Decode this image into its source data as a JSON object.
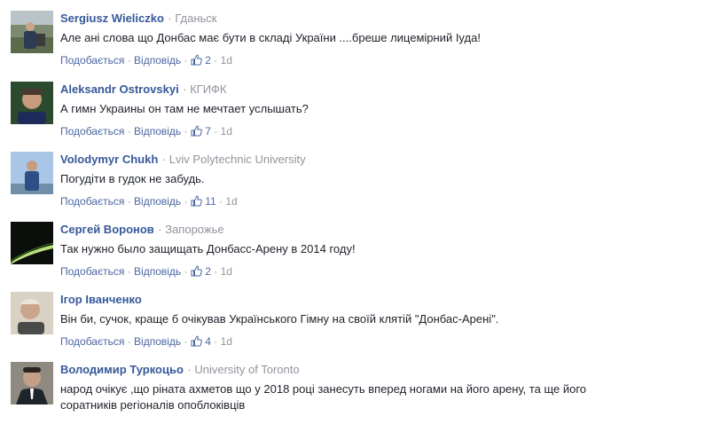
{
  "colors": {
    "author": "#365899",
    "meta": "#90949c",
    "action": "#4b67a1",
    "text": "#1d2129"
  },
  "comments": [
    {
      "author": "Sergiusz Wieliczko",
      "affiliation": "Гданьск",
      "text": "Але ані слова що Донбас має бути в складі України ....бреше лицемірний Іуда!",
      "like_label": "Подобається",
      "reply_label": "Відповідь",
      "likes": "2",
      "time": "1d",
      "avatar": "avatar-man-outdoor"
    },
    {
      "author": "Aleksandr Ostrovskyi",
      "affiliation": "КГИФК",
      "text": "А гимн Украины он там не мечтает услышать?",
      "like_label": "Подобається",
      "reply_label": "Відповідь",
      "likes": "7",
      "time": "1d",
      "avatar": "avatar-man-portrait"
    },
    {
      "author": "Volodymyr Chukh",
      "affiliation": "Lviv Polytechnic University",
      "text": "Погудіти в гудок не забудь.",
      "like_label": "Подобається",
      "reply_label": "Відповідь",
      "likes": "11",
      "time": "1d",
      "avatar": "avatar-man-sky"
    },
    {
      "author": "Сергей Воронов",
      "affiliation": "Запорожье",
      "text": "Так нужно было защищать Донбасс-Арену в 2014 году!",
      "like_label": "Подобається",
      "reply_label": "Відповідь",
      "likes": "2",
      "time": "1d",
      "avatar": "avatar-dark-light"
    },
    {
      "author": "Ігор Іванченко",
      "affiliation": "",
      "text": "Він би, сучок, краще б очікував Українського Гімну на своїй клятій \"Донбас-Арені\".",
      "like_label": "Подобається",
      "reply_label": "Відповідь",
      "likes": "4",
      "time": "1d",
      "avatar": "avatar-older-man"
    },
    {
      "author": "Володимир Туркоцьо",
      "affiliation": "University of Toronto",
      "text": "народ очікує ,що ріната ахметов що у 2018 році занесуть вперед ногами на його арену, та ще його соратників регіоналів опоблоківців",
      "avatar": "avatar-man-suit"
    }
  ]
}
